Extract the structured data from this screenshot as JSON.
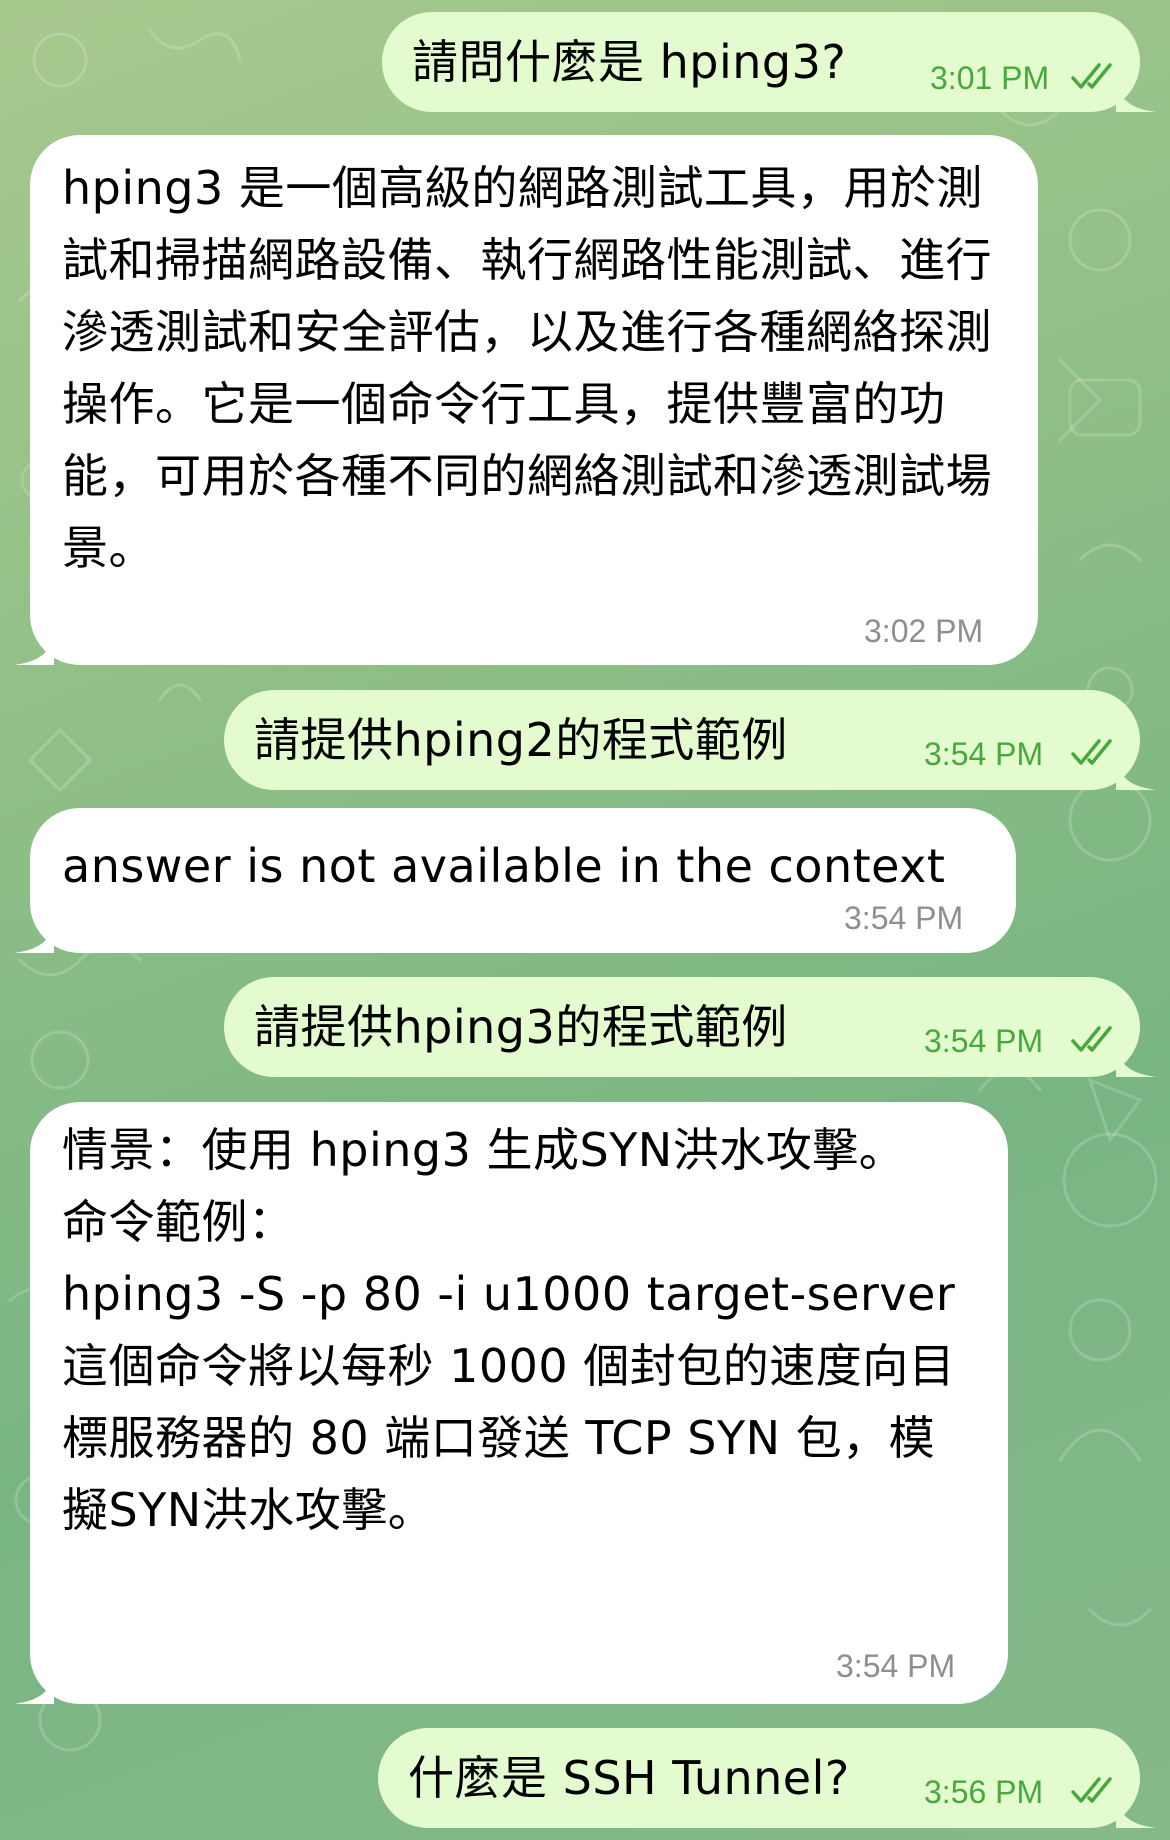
{
  "colors": {
    "outgoing_bubble": "#e3fbcf",
    "incoming_bubble": "#ffffff",
    "outgoing_time": "#47a83c",
    "incoming_time": "#8e8e93",
    "background": "#8fbf86"
  },
  "messages": [
    {
      "direction": "outgoing",
      "text": "請問什麼是 hping3?",
      "time": "3:01 PM",
      "status": "double-check-icon"
    },
    {
      "direction": "incoming",
      "text": "hping3 是一個高級的網路測試工具，用於測試和掃描網路設備、執行網路性能測試、進行滲透測試和安全評估，以及進行各種網絡探測操作。它是一個命令行工具，提供豐富的功能，可用於各種不同的網絡測試和滲透測試場景。",
      "time": "3:02 PM"
    },
    {
      "direction": "outgoing",
      "text": "請提供hping2的程式範例",
      "time": "3:54 PM",
      "status": "double-check-icon"
    },
    {
      "direction": "incoming",
      "text": "answer is not available in the context",
      "time": "3:54 PM"
    },
    {
      "direction": "outgoing",
      "text": "請提供hping3的程式範例",
      "time": "3:54 PM",
      "status": "double-check-icon"
    },
    {
      "direction": "incoming",
      "text": "情景：使用 hping3 生成SYN洪水攻擊。\n命令範例：\nhping3 -S -p 80 -i u1000 target-server\n這個命令將以每秒 1000 個封包的速度向目標服務器的 80 端口發送 TCP SYN 包，模擬SYN洪水攻擊。",
      "time": "3:54 PM"
    },
    {
      "direction": "outgoing",
      "text": "什麼是 SSH Tunnel?",
      "time": "3:56 PM",
      "status": "double-check-icon"
    }
  ]
}
